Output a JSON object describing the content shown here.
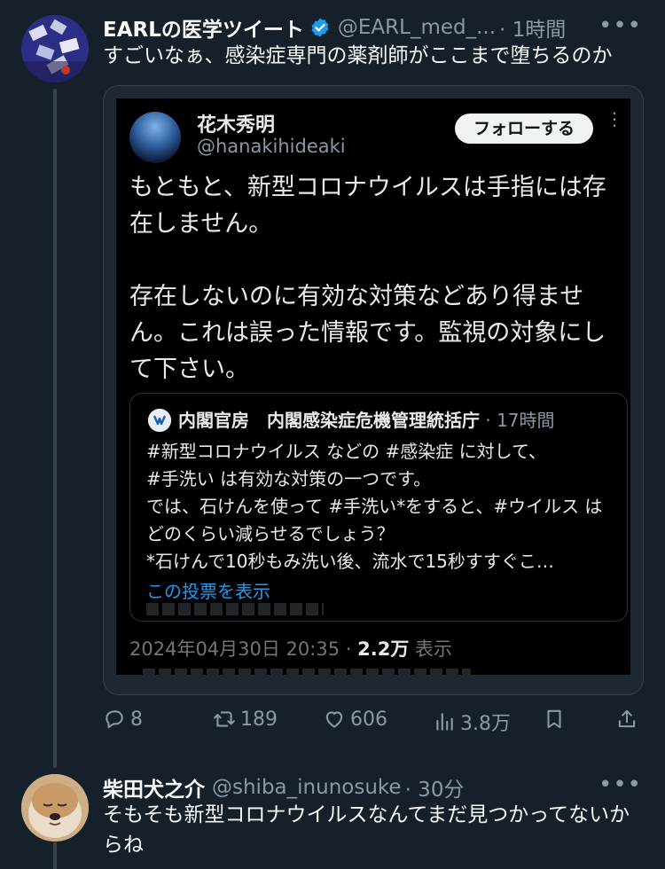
{
  "post": {
    "author_name": "EARLの医学ツイート",
    "handle": "@EARL_med_...",
    "time": "· 1時間",
    "text": "すごいなぁ、感染症専門の薬剤師がここまで堕ちるのか",
    "more": "•••"
  },
  "embedded_screenshot": {
    "name": "花木秀明",
    "handle": "@hanakihideaki",
    "follow_label": "フォローする",
    "more": "⋮",
    "text": "もともと、新型コロナウイルスは手指には存在しません。\n\n存在しないのに有効な対策などあり得ません。これは誤った情報です。監視の対象にして下さい。",
    "quote": {
      "name": "内閣官房　内閣感染症危機管理統括庁",
      "time": "· 17時間",
      "body": "#新型コロナウイルス などの #感染症 に対して、\n#手洗い は有効な対策の一つです。\nでは、石けんを使って #手洗い*をすると、#ウイルス はどのくらい減らせるでしょう？\n*石けんで10秒もみ洗い後、流水で15秒すすぐこ…",
      "link": "この投票を表示"
    },
    "date": "2024年04月30日 20:35",
    "sep": " · ",
    "views_count": "2.2万",
    "views_label": " 表示"
  },
  "actions": {
    "replies": "8",
    "retweets": "189",
    "likes": "606",
    "views": "3.8万"
  },
  "reply": {
    "author_name": "柴田犬之介",
    "handle": "@shiba_inunosuke",
    "time": "· 30分",
    "text": "そもそも新型コロナウイルスなんてまだ見つかってないからね",
    "more": "•••"
  },
  "colors": {
    "background": "#15202b",
    "accent": "#1d9bf0",
    "verified": "#1d9bf0"
  }
}
